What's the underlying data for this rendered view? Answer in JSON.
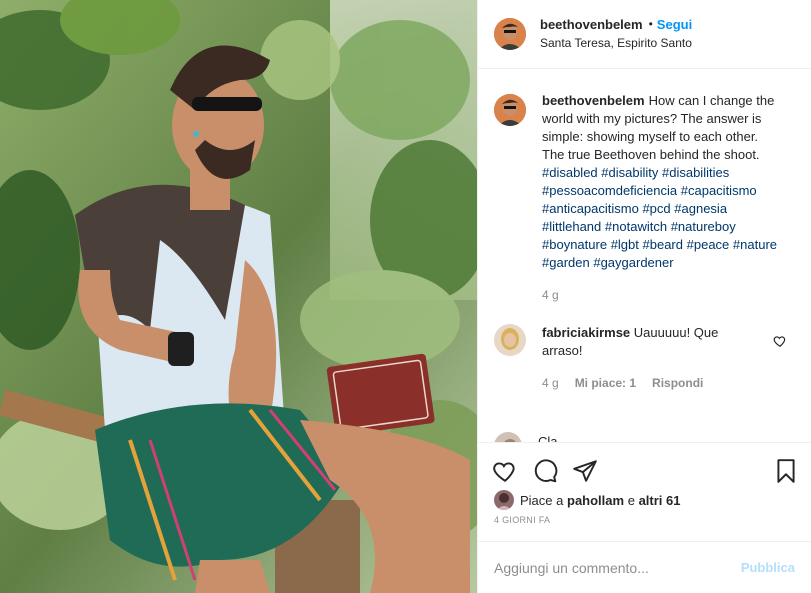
{
  "post_header": {
    "username": "beethovenbelem",
    "separator": "•",
    "follow_label": "Segui",
    "location": "Santa Teresa, Espirito Santo",
    "avatar_icon": "profile-avatar"
  },
  "caption": {
    "username": "beethovenbelem",
    "text": "How can I change the world with my pictures? The answer is simple: showing myself to each other. The true Beethoven behind the shoot.",
    "hashtags": [
      "#disabled",
      "#disability",
      "#disabilities",
      "#pessoacomdeficiencia",
      "#capacitismo",
      "#anticapacitismo",
      "#pcd",
      "#agnesia",
      "#littlehand",
      "#notawitch",
      "#natureboy",
      "#boynature",
      "#lgbt",
      "#beard",
      "#peace",
      "#nature",
      "#garden",
      "#gaygardener"
    ],
    "time": "4 g"
  },
  "comments": [
    {
      "username": "fabriciakirmse",
      "text": "Uauuuuu! Que arraso!",
      "time": "4 g",
      "likes_label": "Mi piace: 1",
      "reply_label": "Rispondi",
      "like_icon": "heart-outline-icon"
    }
  ],
  "comment_peek": {
    "text": "Cla..."
  },
  "actions": {
    "like_icon": "heart-icon",
    "comment_icon": "comment-bubble-icon",
    "share_icon": "paper-plane-icon",
    "save_icon": "bookmark-icon"
  },
  "likes": {
    "prefix": "Piace a",
    "user": "pahollam",
    "connector": "e",
    "others": "altri 61"
  },
  "post_date": "4 giorni fa",
  "comment_box": {
    "placeholder": "Aggiungi un commento...",
    "publish_label": "Pubblica"
  },
  "colors": {
    "link_blue": "#0095f6",
    "hashtag_blue": "#00376b",
    "muted_gray": "#8e8e8e",
    "publish_disabled": "#b2dffc"
  }
}
